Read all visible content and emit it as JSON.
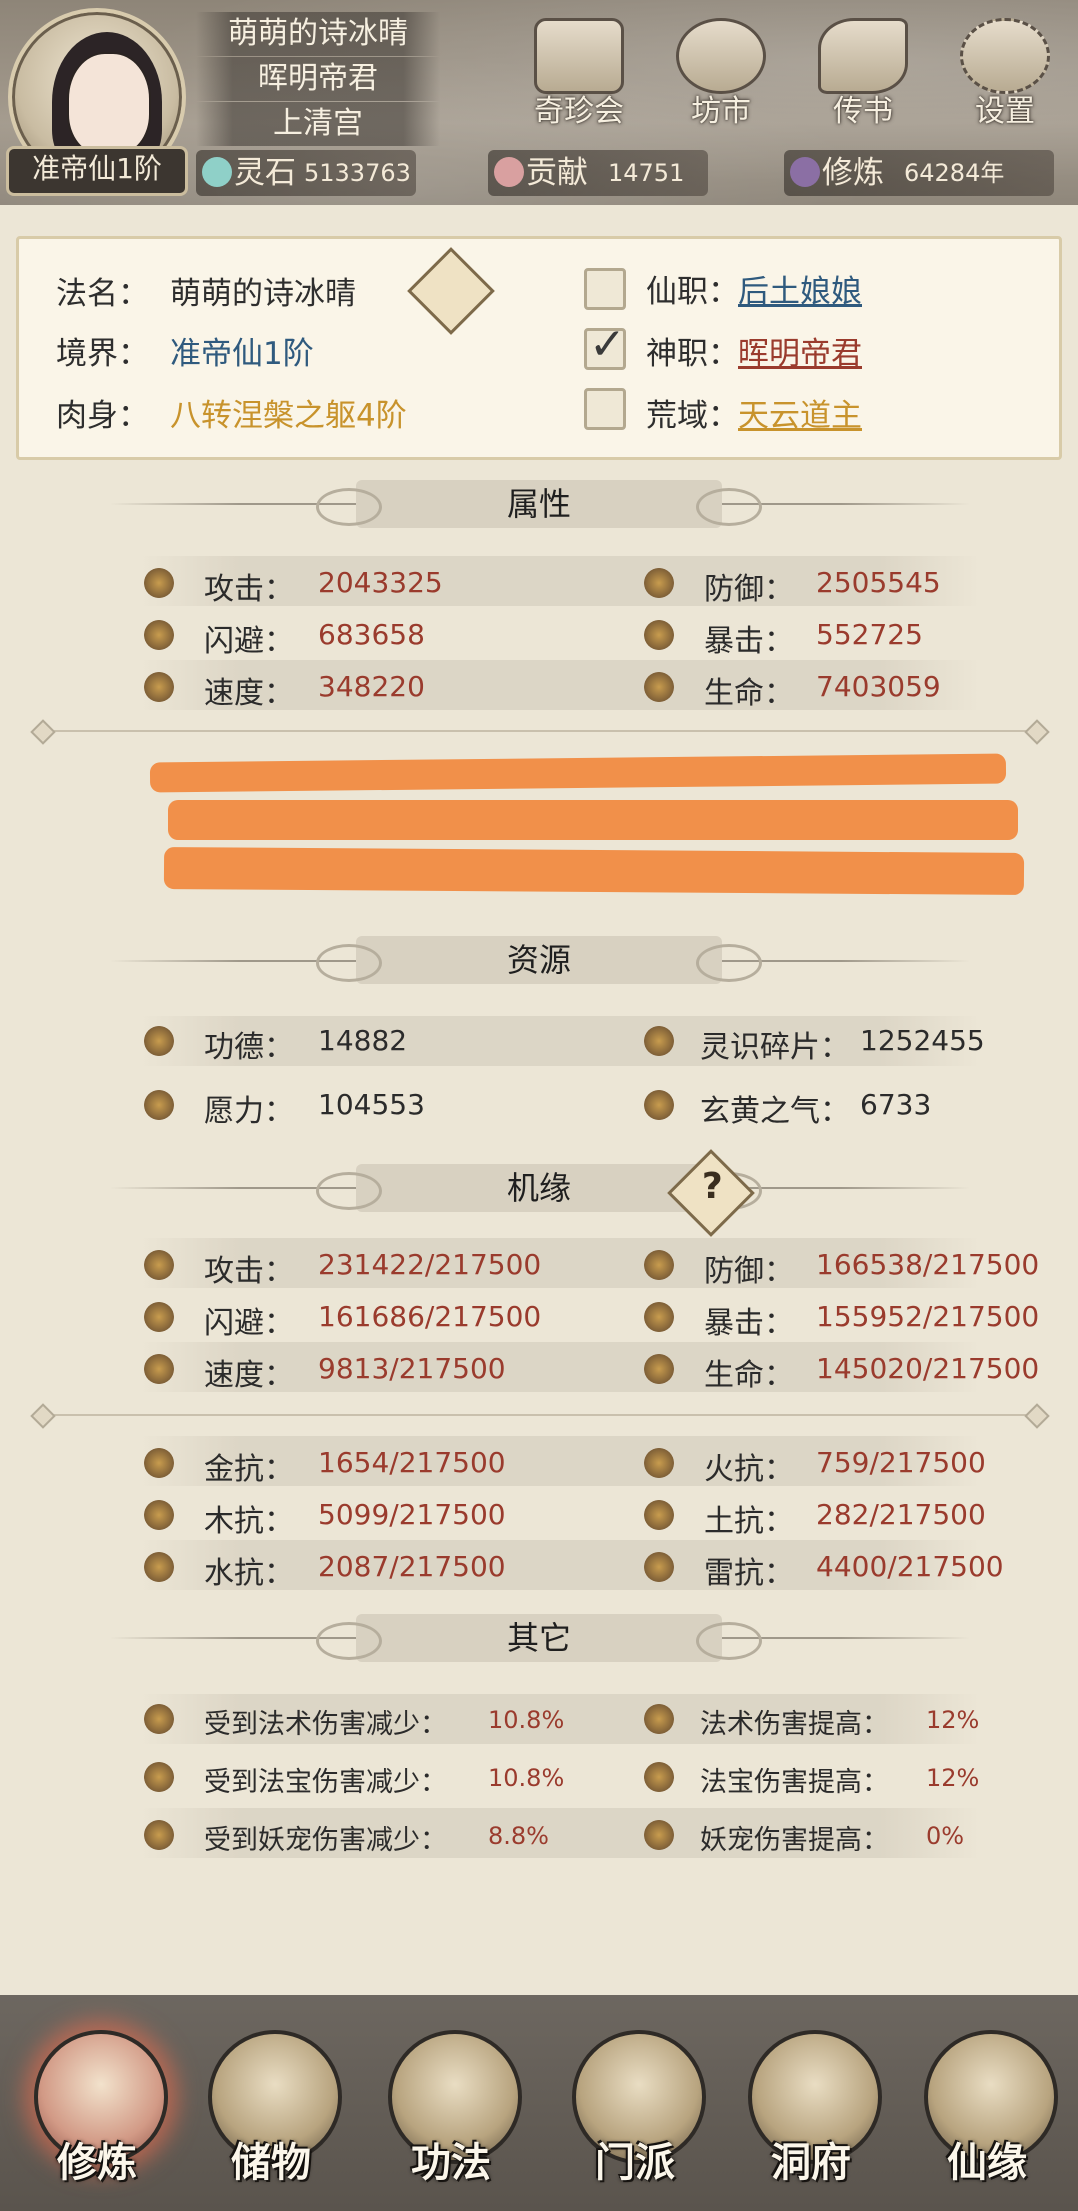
{
  "header": {
    "rank": "准帝仙1阶",
    "names": [
      "萌萌的诗冰晴",
      "晖明帝君",
      "上清宫"
    ],
    "top_buttons": [
      {
        "label": "奇珍会",
        "icon": "treasure-pavilion-icon"
      },
      {
        "label": "坊市",
        "icon": "market-icon"
      },
      {
        "label": "传书",
        "icon": "scroll-letter-icon"
      },
      {
        "label": "设置",
        "icon": "gear-icon"
      }
    ],
    "stats": [
      {
        "label": "灵石",
        "value": "5133763",
        "icon": "spirit-stone-icon"
      },
      {
        "label": "贡献",
        "value": "14751",
        "icon": "contribution-icon"
      },
      {
        "label": "修炼",
        "value": "64284年",
        "icon": "cultivation-icon"
      }
    ]
  },
  "info": {
    "dharma_name_label": "法名：",
    "dharma_name": "萌萌的诗冰晴",
    "realm_label": "境界：",
    "realm": "准帝仙1阶",
    "body_label": "肉身：",
    "body": "八转涅槃之躯4阶",
    "posts": [
      {
        "label": "仙职：",
        "value": "后土娘娘",
        "checked": false
      },
      {
        "label": "神职：",
        "value": "晖明帝君",
        "checked": true
      },
      {
        "label": "荒域：",
        "value": "天云道主",
        "checked": false
      }
    ]
  },
  "attributes": {
    "title": "属性",
    "rows": [
      {
        "left": {
          "label": "攻击：",
          "value": "2043325",
          "icon": "attack-icon"
        },
        "right": {
          "label": "防御：",
          "value": "2505545",
          "icon": "defense-icon"
        }
      },
      {
        "left": {
          "label": "闪避：",
          "value": "683658",
          "icon": "dodge-icon"
        },
        "right": {
          "label": "暴击：",
          "value": "552725",
          "icon": "crit-icon"
        }
      },
      {
        "left": {
          "label": "速度：",
          "value": "348220",
          "icon": "speed-icon"
        },
        "right": {
          "label": "生命：",
          "value": "7403059",
          "icon": "life-icon"
        }
      }
    ]
  },
  "resources": {
    "title": "资源",
    "rows": [
      {
        "left": {
          "label": "功德：",
          "value": "14882",
          "icon": "merit-icon"
        },
        "right": {
          "label": "灵识碎片：",
          "value": "1252455",
          "icon": "spirit-shard-icon"
        }
      },
      {
        "left": {
          "label": "愿力：",
          "value": "104553",
          "icon": "wish-power-icon"
        },
        "right": {
          "label": "玄黄之气：",
          "value": "6733",
          "icon": "xuanhuang-qi-icon"
        }
      }
    ]
  },
  "fortune": {
    "title": "机缘",
    "help_icon": "help-icon",
    "rows": [
      {
        "left": {
          "label": "攻击：",
          "value": "231422/217500",
          "icon": "attack-icon"
        },
        "right": {
          "label": "防御：",
          "value": "166538/217500",
          "icon": "defense-icon"
        }
      },
      {
        "left": {
          "label": "闪避：",
          "value": "161686/217500",
          "icon": "dodge-icon"
        },
        "right": {
          "label": "暴击：",
          "value": "155952/217500",
          "icon": "crit-icon"
        }
      },
      {
        "left": {
          "label": "速度：",
          "value": "9813/217500",
          "icon": "speed-icon"
        },
        "right": {
          "label": "生命：",
          "value": "145020/217500",
          "icon": "life-icon"
        }
      }
    ],
    "resist_rows": [
      {
        "left": {
          "label": "金抗：",
          "value": "1654/217500",
          "icon": "metal-resist-icon"
        },
        "right": {
          "label": "火抗：",
          "value": "759/217500",
          "icon": "fire-resist-icon"
        }
      },
      {
        "left": {
          "label": "木抗：",
          "value": "5099/217500",
          "icon": "wood-resist-icon"
        },
        "right": {
          "label": "土抗：",
          "value": "282/217500",
          "icon": "earth-resist-icon"
        }
      },
      {
        "left": {
          "label": "水抗：",
          "value": "2087/217500",
          "icon": "water-resist-icon"
        },
        "right": {
          "label": "雷抗：",
          "value": "4400/217500",
          "icon": "thunder-resist-icon"
        }
      }
    ]
  },
  "others": {
    "title": "其它",
    "rows": [
      {
        "left": {
          "label": "受到法术伤害减少：",
          "value": "10.8%"
        },
        "right": {
          "label": "法术伤害提高：",
          "value": "12%"
        }
      },
      {
        "left": {
          "label": "受到法宝伤害减少：",
          "value": "10.8%"
        },
        "right": {
          "label": "法宝伤害提高：",
          "value": "12%"
        }
      },
      {
        "left": {
          "label": "受到妖宠伤害减少：",
          "value": "8.8%"
        },
        "right": {
          "label": "妖宠伤害提高：",
          "value": "0%"
        }
      }
    ]
  },
  "nav": [
    {
      "label": "修炼",
      "icon": "cultivation-nav-icon",
      "active": true
    },
    {
      "label": "储物",
      "icon": "storage-bag-icon",
      "active": false
    },
    {
      "label": "功法",
      "icon": "technique-scroll-icon",
      "active": false
    },
    {
      "label": "门派",
      "icon": "sect-gate-icon",
      "active": false
    },
    {
      "label": "洞府",
      "icon": "cave-dwelling-icon",
      "active": false
    },
    {
      "label": "仙缘",
      "icon": "immortal-fate-icon",
      "active": false
    }
  ],
  "colors": {
    "value_red": "#9a3b2d",
    "link_blue": "#2f5a7e",
    "body_gold": "#c8932c",
    "redaction": "#f1904a"
  }
}
